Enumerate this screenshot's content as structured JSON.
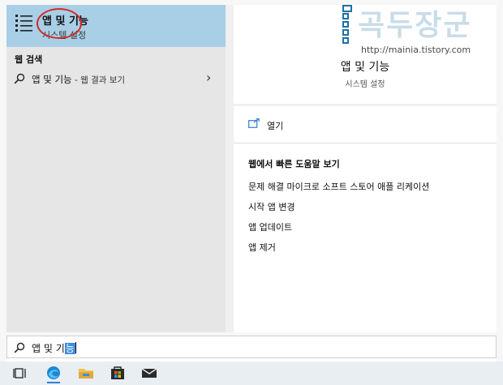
{
  "best_match": {
    "title": "앱 및 기능",
    "subtitle": "시스템 설정"
  },
  "left": {
    "section_header": "웹 검색",
    "web_result": {
      "query": "앱 및 기능",
      "detail": " - 웹 결과 보기"
    }
  },
  "right": {
    "title": "앱 및 기능",
    "subtitle": "시스템 설정",
    "open_label": "열기",
    "help_header": "웹에서 빠른 도움말 보기",
    "help_links": [
      "문제 해결 마이크로 소프트 스토어 애플 리케이션",
      "시작 앱 변경",
      "앱 업데이트",
      "앱 제거"
    ]
  },
  "watermark": {
    "title": "곡두장군",
    "url": "http://mainia.tistory.com"
  },
  "search": {
    "typed_plain": "앱 및 기",
    "typed_selected": "능"
  },
  "taskbar": {
    "icons": [
      "task-view-icon",
      "edge-icon",
      "file-explorer-icon",
      "store-icon",
      "mail-icon"
    ]
  },
  "colors": {
    "best_match_bg": "#a8cfe6",
    "panel_bg": "#e6e6e6",
    "annotation_circle": "#d42828",
    "accent": "#2f7fd1"
  }
}
